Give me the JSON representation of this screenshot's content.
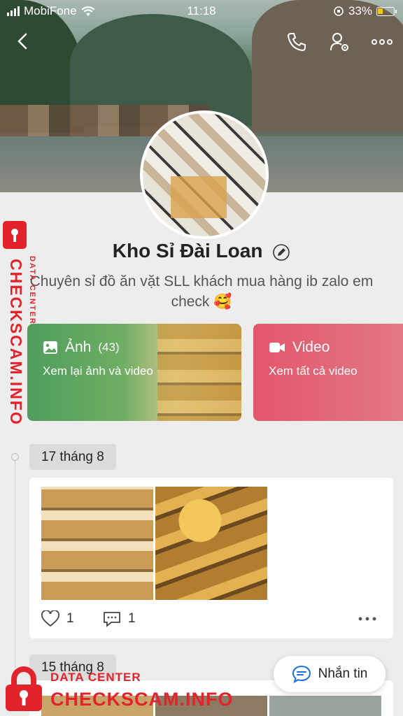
{
  "status_bar": {
    "carrier": "MobiFone",
    "time": "11:18",
    "battery": "33%"
  },
  "profile": {
    "name": "Kho Sỉ Đài Loan",
    "bio_line1": "Chuyên sỉ đồ ăn vặt SLL khách mua hàng ib zalo em",
    "bio_line2": "check 🥰"
  },
  "cards": {
    "photos": {
      "label": "Ảnh",
      "count": "(43)",
      "sub": "Xem lại ảnh và video"
    },
    "videos": {
      "label": "Video",
      "sub": "Xem tất cả video"
    }
  },
  "timeline": {
    "groups": [
      {
        "date": "17 tháng 8",
        "likes": "1",
        "comments": "1"
      },
      {
        "date": "15 tháng 8"
      }
    ]
  },
  "message_button": "Nhắn tin",
  "watermark": {
    "top": "DATA CENTER",
    "brand": "CHECKSCAM.INFO"
  },
  "colors": {
    "photo_card": "#4f9d5d",
    "video_card": "#e3566b",
    "watermark": "#e3232b"
  }
}
